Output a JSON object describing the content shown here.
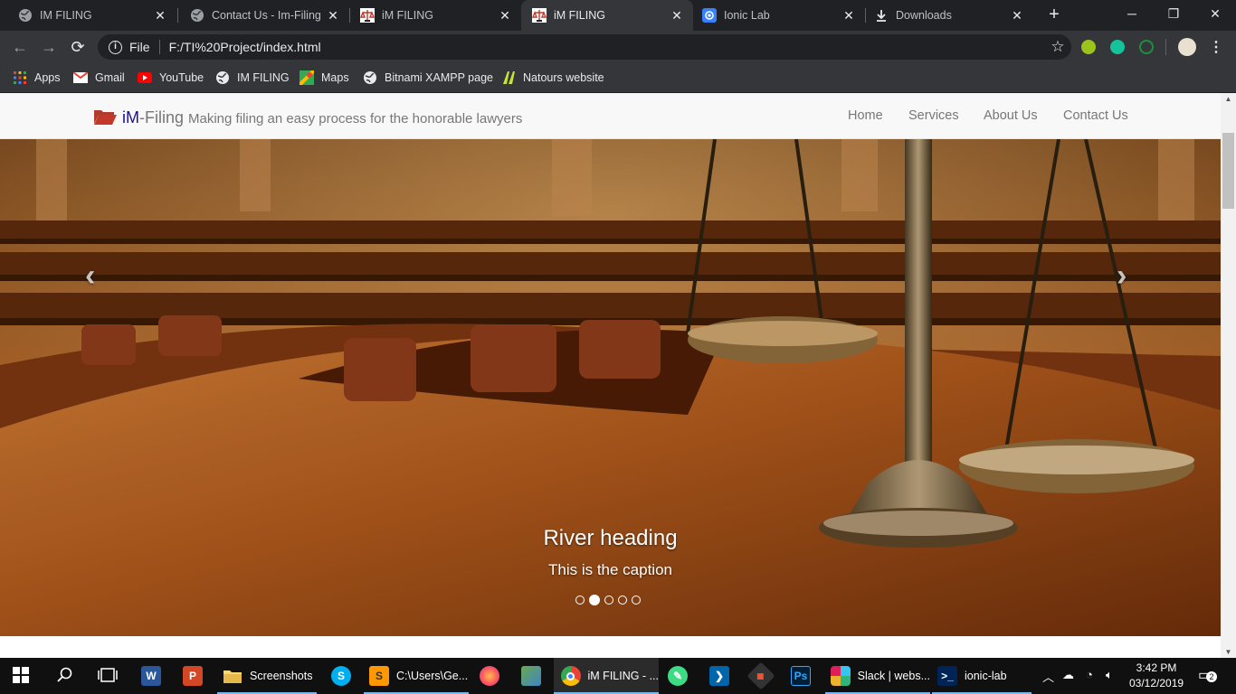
{
  "tabs": [
    {
      "title": "IM FILING",
      "icon": "globe-icon",
      "active": false
    },
    {
      "title": "Contact Us - Im-Filing",
      "icon": "globe-icon",
      "active": false
    },
    {
      "title": "iM FILING",
      "icon": "scales-favicon-icon",
      "active": false
    },
    {
      "title": "iM FILING",
      "icon": "scales-favicon-icon",
      "active": true
    },
    {
      "title": "Ionic Lab",
      "icon": "ionic-icon",
      "active": false
    },
    {
      "title": "Downloads",
      "icon": "download-icon",
      "active": false
    }
  ],
  "toolbar": {
    "scheme": "File",
    "url": "F:/TI%20Project/index.html"
  },
  "bookmarks": [
    {
      "label": "Apps",
      "icon": "apps-grid-icon"
    },
    {
      "label": "Gmail",
      "icon": "gmail-icon"
    },
    {
      "label": "YouTube",
      "icon": "youtube-icon"
    },
    {
      "label": "IM FILING",
      "icon": "globe-icon"
    },
    {
      "label": "Maps",
      "icon": "maps-icon"
    },
    {
      "label": "Bitnami XAMPP page",
      "icon": "globe-icon"
    },
    {
      "label": "Natours website",
      "icon": "natours-icon"
    }
  ],
  "site": {
    "brand_prefix": "iM",
    "brand_rest": "-Filing",
    "tagline": "Making filing an easy process for the honorable lawyers",
    "nav": [
      "Home",
      "Services",
      "About Us",
      "Contact Us"
    ]
  },
  "carousel": {
    "heading": "River heading",
    "caption": "This is the caption",
    "slide_count": 5,
    "active_slide": 2,
    "prev_symbol": "‹",
    "next_symbol": "›"
  },
  "taskbar": {
    "items": [
      {
        "label": "",
        "icon": "word-icon"
      },
      {
        "label": "",
        "icon": "powerpoint-icon"
      },
      {
        "label": "Screenshots",
        "icon": "folder-icon"
      },
      {
        "label": "",
        "icon": "skype-icon"
      },
      {
        "label": "C:\\Users\\Ge...",
        "icon": "sublime-text-icon"
      },
      {
        "label": "",
        "icon": "firefox-icon"
      },
      {
        "label": "",
        "icon": "app-icon"
      },
      {
        "label": "iM FILING - ...",
        "icon": "chrome-icon"
      },
      {
        "label": "",
        "icon": "android-studio-icon"
      },
      {
        "label": "",
        "icon": "vscode-icon"
      },
      {
        "label": "",
        "icon": "git-icon"
      },
      {
        "label": "",
        "icon": "photoshop-icon"
      },
      {
        "label": "Slack | webs...",
        "icon": "slack-icon"
      },
      {
        "label": "ionic-lab",
        "icon": "powershell-icon"
      }
    ],
    "time": "3:42 PM",
    "date": "03/12/2019",
    "notification_count": "2"
  },
  "colors": {
    "browser_bg": "#202124",
    "toolbar_bg": "#35363a",
    "brand_blue": "#1a0dab",
    "folder_red": "#b03a2e",
    "taskbar_bg": "#101010"
  }
}
